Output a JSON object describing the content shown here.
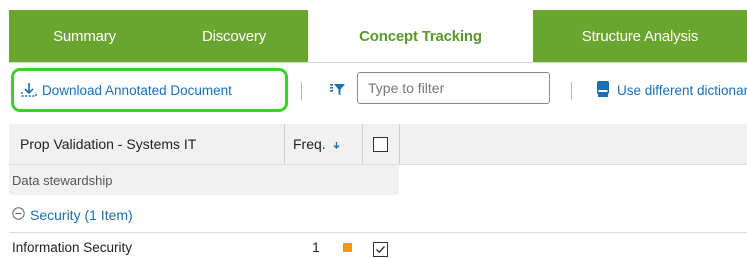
{
  "tabs": [
    {
      "label": "Summary",
      "active": false
    },
    {
      "label": "Discovery",
      "active": false
    },
    {
      "label": "Concept Tracking",
      "active": true
    },
    {
      "label": "Structure Analysis",
      "active": false
    }
  ],
  "toolbar": {
    "download_label": "Download Annotated Document",
    "filter_placeholder": "Type to filter",
    "dictionary_label": "Use different dictionary"
  },
  "grid": {
    "columns": {
      "name": "Prop Validation - Systems IT",
      "freq": "Freq."
    },
    "section_label": "Data stewardship",
    "group": {
      "label": "Security (1 Item)",
      "expanded": true
    },
    "rows": [
      {
        "name": "Information Security",
        "freq": "1",
        "checked": true
      }
    ]
  },
  "colors": {
    "tab_green": "#6aa52f",
    "active_tab_text": "#5b9a2a",
    "highlight": "#3fcf2d",
    "link_blue": "#1a6fb5",
    "marker_orange": "#f29b12"
  },
  "icons": [
    "download-icon",
    "filter-icon",
    "dictionary-icon",
    "sort-down-icon",
    "collapse-icon",
    "checkbox-icon"
  ]
}
